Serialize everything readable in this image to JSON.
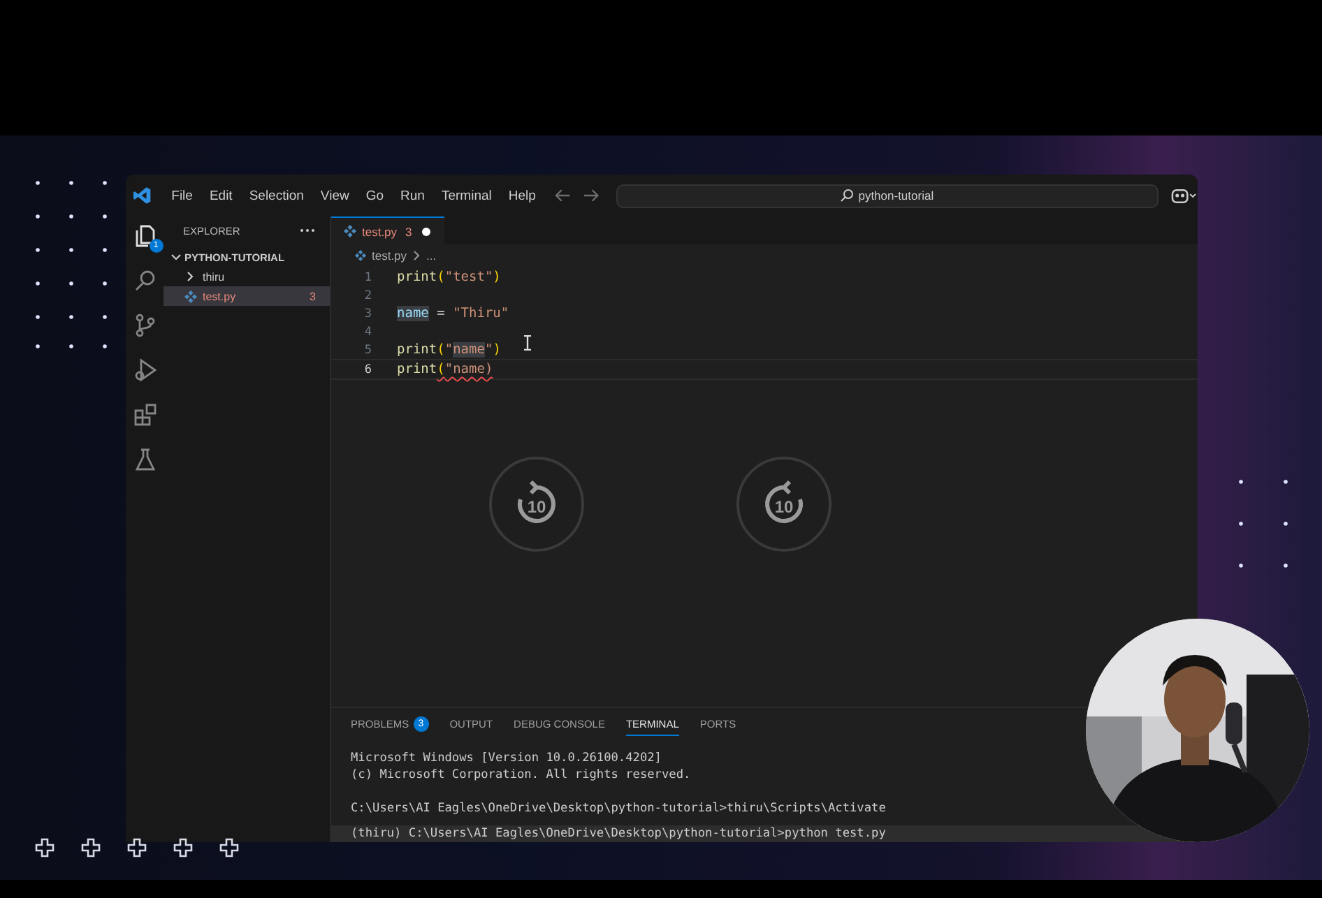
{
  "title_bar": {
    "menu": [
      "File",
      "Edit",
      "Selection",
      "View",
      "Go",
      "Run",
      "Terminal",
      "Help"
    ],
    "search": {
      "value": "python-tutorial"
    }
  },
  "activity_bar": [
    {
      "kind": "explorer",
      "selected": true,
      "badge": "1"
    },
    {
      "kind": "search",
      "selected": false
    },
    {
      "kind": "source-control",
      "selected": false
    },
    {
      "kind": "run-debug",
      "selected": false
    },
    {
      "kind": "extensions",
      "selected": false
    },
    {
      "kind": "testing",
      "selected": false
    }
  ],
  "sidebar": {
    "title": "EXPLORER",
    "folder": {
      "name": "PYTHON-TUTORIAL",
      "expanded": true,
      "children": [
        {
          "name": "thiru",
          "kind": "folder",
          "expanded": false,
          "selected": false
        },
        {
          "name": "test.py",
          "kind": "python",
          "selected": true,
          "problems": "3"
        }
      ]
    }
  },
  "editor": {
    "tab": {
      "name": "test.py",
      "problems": "3",
      "modified": true
    },
    "breadcrumb": [
      "test.py",
      "..."
    ],
    "lines": [
      {
        "number": "1",
        "current": false,
        "tokens": [
          {
            "text": "print",
            "kind": "fn",
            "highlighted": false,
            "error": false
          },
          {
            "text": "(",
            "kind": "paren",
            "highlighted": false,
            "error": false
          },
          {
            "text": "\"test\"",
            "kind": "str",
            "highlighted": false,
            "error": false
          },
          {
            "text": ")",
            "kind": "paren",
            "highlighted": false,
            "error": false
          }
        ]
      },
      {
        "number": "2",
        "current": false
      },
      {
        "number": "3",
        "current": false,
        "tokens": [
          {
            "text": "name",
            "kind": "var",
            "highlighted": true,
            "error": false
          },
          {
            "text": " = ",
            "kind": "op",
            "highlighted": false,
            "error": false
          },
          {
            "text": "\"Thiru\"",
            "kind": "str",
            "highlighted": false,
            "error": false
          }
        ]
      },
      {
        "number": "4",
        "current": false
      },
      {
        "number": "5",
        "current": false,
        "tokens": [
          {
            "text": "print",
            "kind": "fn",
            "highlighted": false,
            "error": false
          },
          {
            "text": "(",
            "kind": "paren",
            "highlighted": false,
            "error": false
          },
          {
            "text": "\"",
            "kind": "str",
            "highlighted": false,
            "error": false
          },
          {
            "text": "name",
            "kind": "str",
            "highlighted": true,
            "error": false
          },
          {
            "text": "\"",
            "kind": "str",
            "highlighted": false,
            "error": false
          },
          {
            "text": ")",
            "kind": "paren",
            "highlighted": false,
            "error": false
          }
        ]
      },
      {
        "number": "6",
        "current": true,
        "tokens": [
          {
            "text": "print",
            "kind": "fn",
            "highlighted": false,
            "error": false
          },
          {
            "text": "(",
            "kind": "paren",
            "highlighted": false,
            "error": true
          },
          {
            "text": "\"name)",
            "kind": "str",
            "highlighted": false,
            "error": true
          }
        ]
      }
    ]
  },
  "player_controls": [
    {
      "kind": "rewind",
      "label": "10"
    },
    {
      "kind": "forward",
      "label": "10"
    }
  ],
  "panel": {
    "tabs": [
      {
        "label": "PROBLEMS",
        "badge": "3",
        "selected": false
      },
      {
        "label": "OUTPUT",
        "selected": false
      },
      {
        "label": "DEBUG CONSOLE",
        "selected": false
      },
      {
        "label": "TERMINAL",
        "selected": true
      },
      {
        "label": "PORTS",
        "selected": false
      }
    ],
    "terminal": [
      {
        "text": "Microsoft Windows [Version 10.0.26100.4202]",
        "kind": "output",
        "highlighted": false
      },
      {
        "text": "(c) Microsoft Corporation. All rights reserved.",
        "kind": "output",
        "highlighted": false
      },
      {
        "text": "C:\\Users\\AI Eagles\\OneDrive\\Desktop\\python-tutorial>thiru\\Scripts\\Activate",
        "kind": "prompt",
        "highlighted": false
      },
      {
        "text": "(thiru) C:\\Users\\AI Eagles\\OneDrive\\Desktop\\python-tutorial>python test.py",
        "kind": "prompt",
        "highlighted": true
      }
    ]
  }
}
